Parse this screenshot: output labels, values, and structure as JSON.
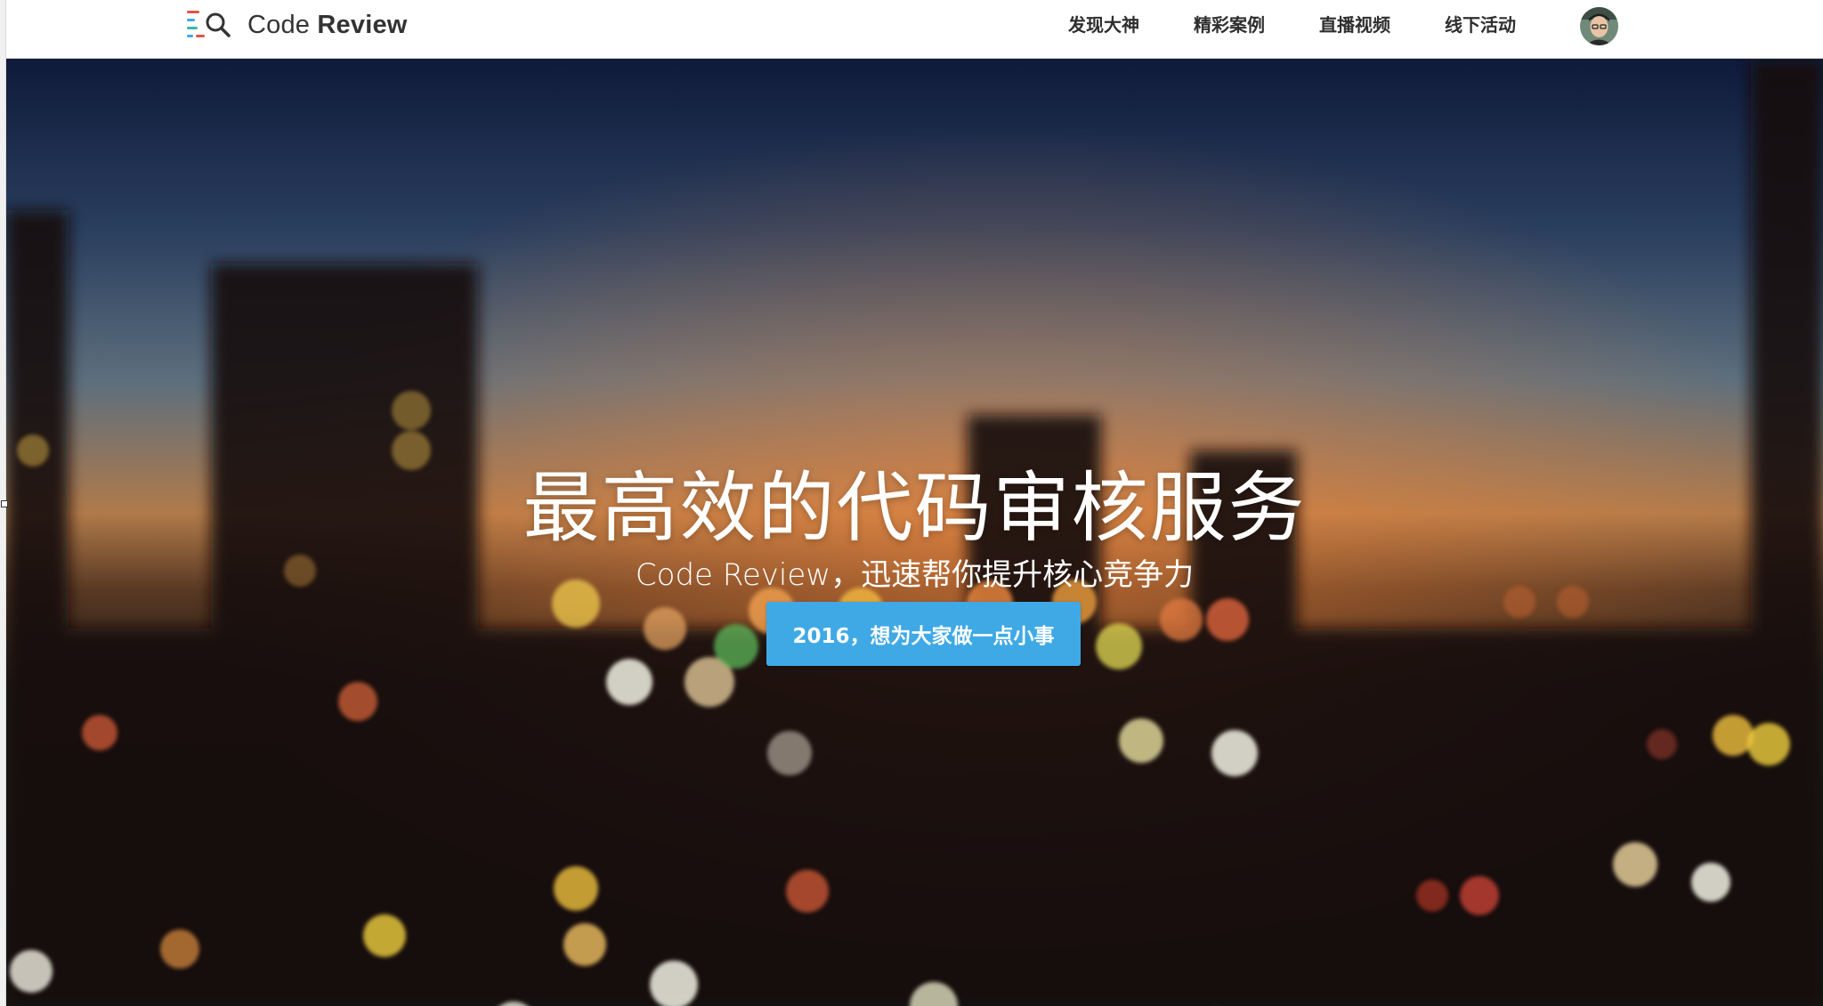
{
  "header": {
    "logo": {
      "text_light": "Code ",
      "text_bold": "Review",
      "icon": "code-search-logo-icon"
    },
    "nav": [
      {
        "label": "发现大神"
      },
      {
        "label": "精彩案例"
      },
      {
        "label": "直播视频"
      },
      {
        "label": "线下活动"
      }
    ],
    "avatar_icon": "user-avatar"
  },
  "hero": {
    "title": "最高效的代码审核服务",
    "subtitle": "Code Review，迅速帮你提升核心竞争力",
    "cta_label": "2016，想为大家做一点小事",
    "background": "blurred-city-night-bokeh"
  },
  "colors": {
    "accent": "#3fa9e6",
    "nav_text": "#2e2e2e",
    "hero_text": "#ffffff",
    "logo_red": "#e2524a",
    "logo_blue": "#3fa9e6",
    "logo_teal": "#3db8a8"
  }
}
